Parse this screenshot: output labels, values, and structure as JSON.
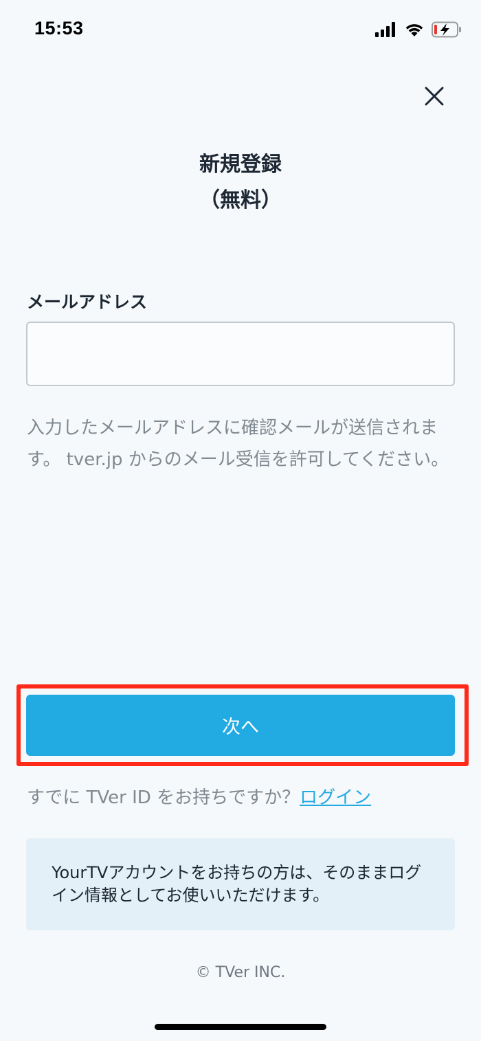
{
  "status_bar": {
    "time": "15:53"
  },
  "close": {
    "icon": "close-icon"
  },
  "title": {
    "line1": "新規登録",
    "line2": "（無料）"
  },
  "email": {
    "label": "メールアドレス",
    "value": "",
    "placeholder": ""
  },
  "hint": "入力したメールアドレスに確認メールが送信されます。 tver.jp からのメール受信を許可してください。",
  "next_button": {
    "label": "次へ"
  },
  "login": {
    "prompt": "すでに TVer ID をお持ちですか？",
    "link": "ログイン"
  },
  "info": "YourTVアカウントをお持ちの方は、そのままログイン情報としてお使いいただけます。",
  "footer": {
    "copyright": "© TVer INC."
  },
  "colors": {
    "background": "#f6f9fb",
    "accent": "#22aae3",
    "highlight": "#ff2a17",
    "info_bg": "#e3f0f8"
  }
}
